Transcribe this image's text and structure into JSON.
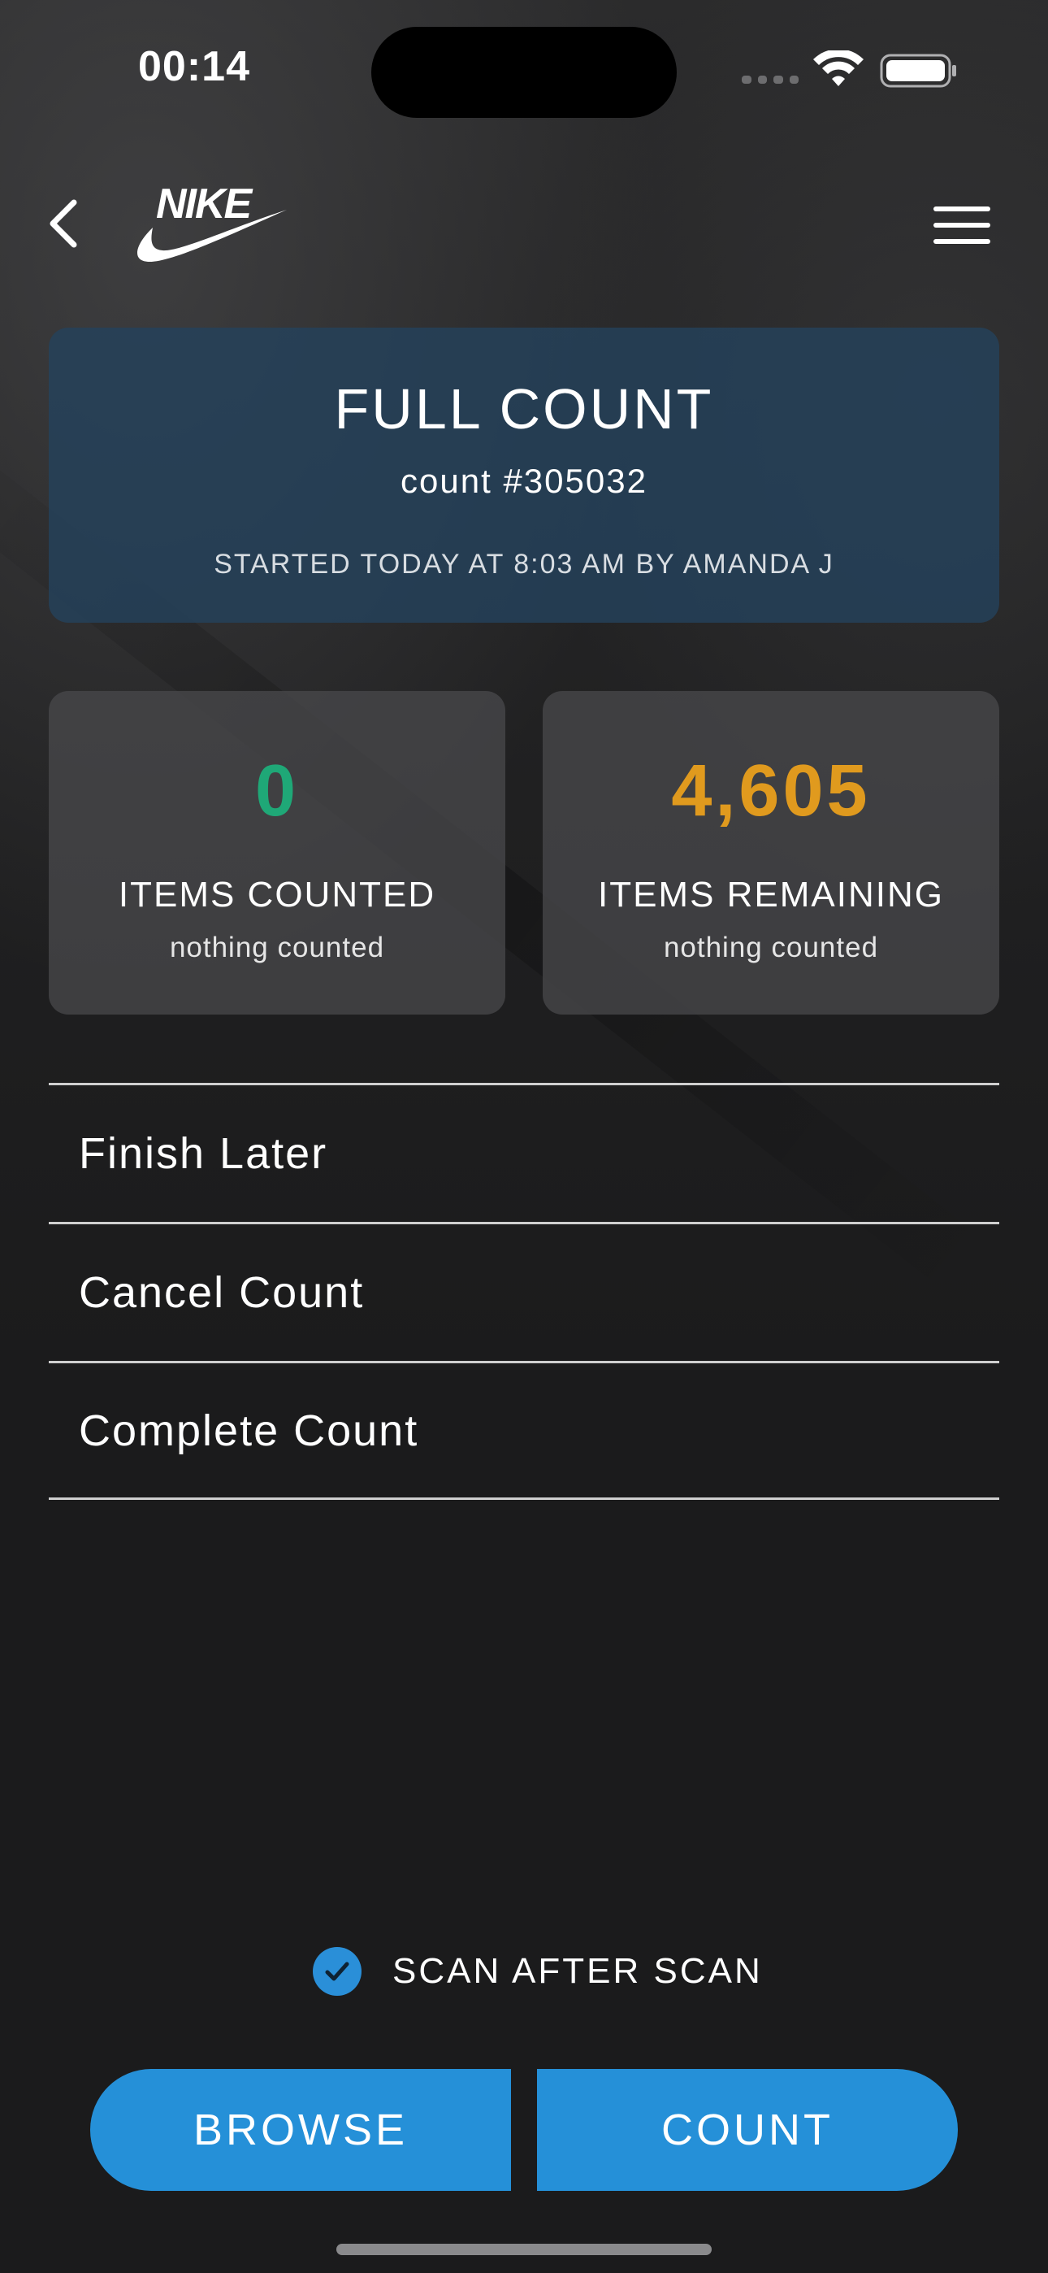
{
  "status_bar": {
    "time": "00:14"
  },
  "nav": {
    "brand": "NIKE",
    "icons": {
      "back": "chevron-left-icon",
      "menu": "hamburger-menu-icon",
      "logo": "nike-swoosh-logo"
    }
  },
  "header": {
    "title": "FULL COUNT",
    "count_id": "count #305032",
    "started": "STARTED TODAY AT 8:03 AM BY AMANDA J"
  },
  "stats": {
    "counted": {
      "value": "0",
      "label": "ITEMS COUNTED",
      "note": "nothing counted",
      "color": "#1fa877"
    },
    "remaining": {
      "value": "4,605",
      "label": "ITEMS REMAINING",
      "note": "nothing counted",
      "color": "#e09a1e"
    }
  },
  "actions": [
    {
      "label": "Finish Later"
    },
    {
      "label": "Cancel Count"
    },
    {
      "label": "Complete Count"
    }
  ],
  "scan_after_scan": {
    "label": "SCAN AFTER SCAN",
    "checked": true
  },
  "buttons": {
    "browse": "BROWSE",
    "count": "COUNT",
    "accent": "#2590d8"
  }
}
